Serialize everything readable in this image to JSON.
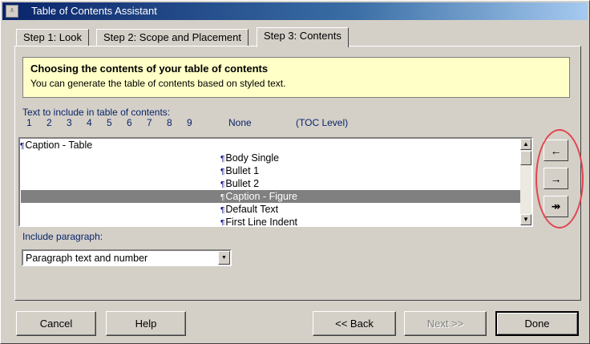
{
  "window": {
    "title": "Table of Contents Assistant"
  },
  "tabs": [
    {
      "label": "Step 1:  Look"
    },
    {
      "label": "Step 2:  Scope and Placement"
    },
    {
      "label": "Step 3:  Contents"
    }
  ],
  "info": {
    "title": "Choosing the contents of your table of contents",
    "text": "You can generate the table of contents based on styled text."
  },
  "include": {
    "label": "Text to include in table of contents:",
    "levels": [
      "1",
      "2",
      "3",
      "4",
      "5",
      "6",
      "7",
      "8",
      "9"
    ],
    "none_label": "None",
    "toc_level_label": "(TOC Level)",
    "items": [
      {
        "text": "Caption - Table",
        "selected": false
      },
      {
        "text": "Body Single",
        "selected": false
      },
      {
        "text": "Bullet 1",
        "selected": false
      },
      {
        "text": "Bullet 2",
        "selected": false
      },
      {
        "text": "Caption - Figure",
        "selected": true
      },
      {
        "text": "Default Text",
        "selected": false
      },
      {
        "text": "First Line Indent",
        "selected": false
      }
    ]
  },
  "arrows": {
    "left": "←",
    "right": "→",
    "double_right": "↠"
  },
  "paragraph": {
    "label": "Include paragraph:",
    "selected": "Paragraph text and number"
  },
  "buttons": {
    "cancel": "Cancel",
    "help": "Help",
    "back": "<< Back",
    "next": "Next >>",
    "done": "Done"
  },
  "icons": {
    "system_menu": "system-menu-icon",
    "pilcrow": "¶",
    "scroll_up": "▲",
    "scroll_down": "▼",
    "dropdown": "▼"
  }
}
